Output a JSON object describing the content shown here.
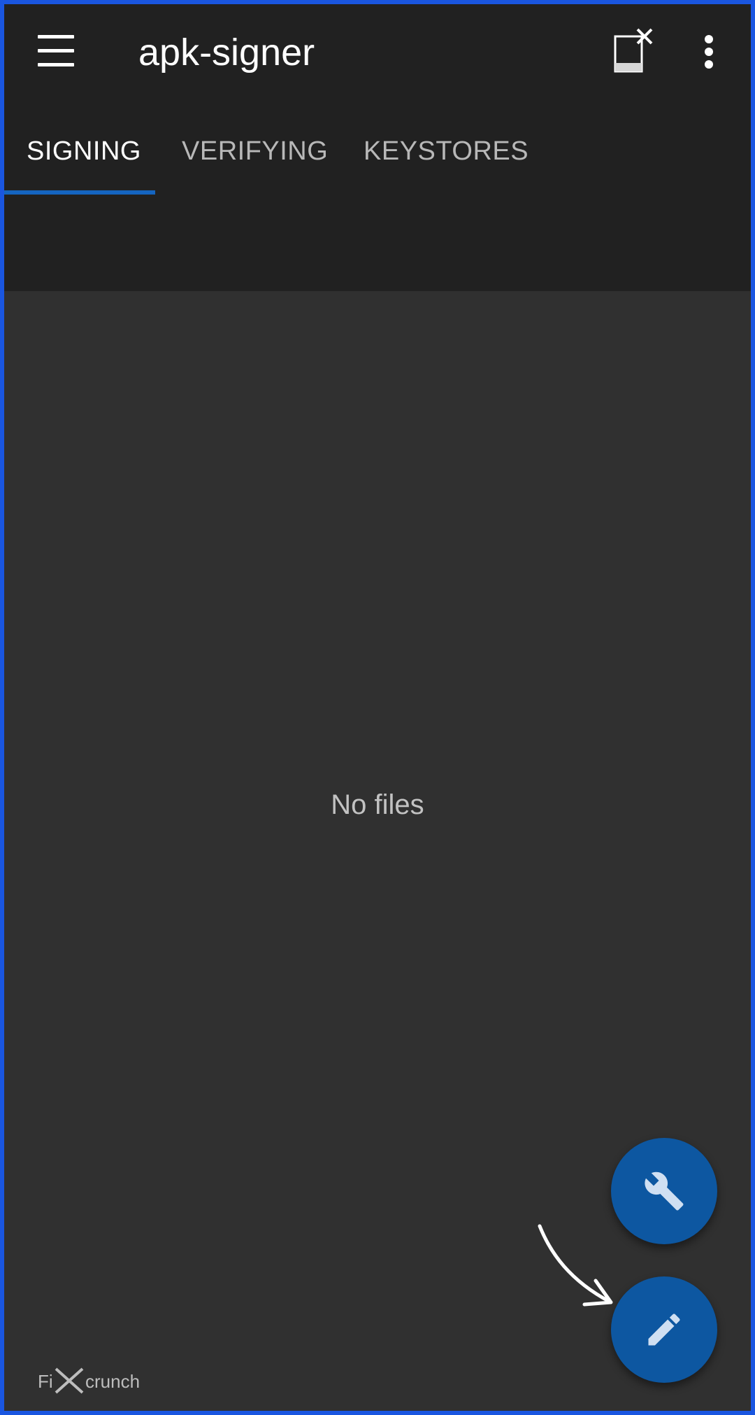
{
  "app_bar": {
    "title": "apk-signer",
    "menu_icon": "hamburger-menu-icon",
    "mode_icon": "window-mode-icon",
    "overflow_icon": "more-vert-icon"
  },
  "tabs": [
    {
      "label": "SIGNING",
      "active": true
    },
    {
      "label": "VERIFYING",
      "active": false
    },
    {
      "label": "KEYSTORES",
      "active": false
    }
  ],
  "content": {
    "empty_message": "No files"
  },
  "fabs": {
    "tools_icon": "wrench-icon",
    "sign_icon": "pencil-icon"
  },
  "watermark": {
    "text": "FiXcrunch"
  },
  "colors": {
    "app_bar_bg": "#212121",
    "content_bg": "#303030",
    "accent": "#1565c0",
    "fab_bg": "#0d57a1",
    "frame": "#1a56e0"
  }
}
